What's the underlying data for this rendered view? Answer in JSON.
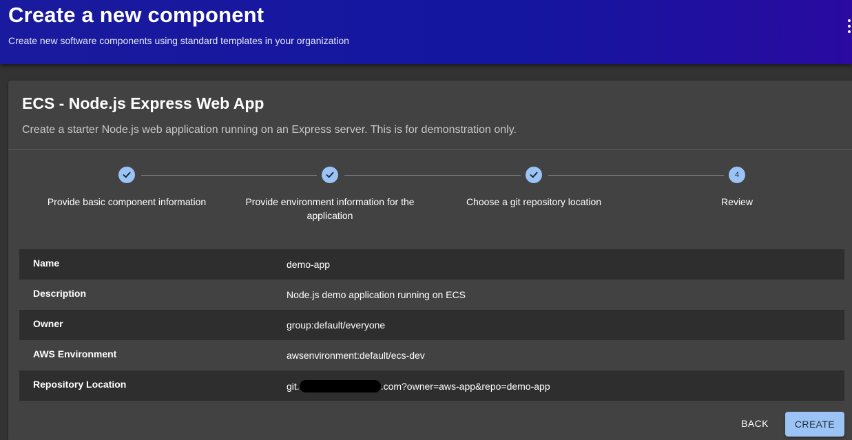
{
  "header": {
    "title": "Create a new component",
    "subtitle": "Create new software components using standard templates in your organization",
    "menu_icon": "more-vertical-icon"
  },
  "template": {
    "title": "ECS - Node.js Express Web App",
    "description": "Create a starter Node.js web application running on an Express server. This is for demonstration only."
  },
  "stepper": {
    "steps": [
      {
        "label": "Provide basic component information",
        "state": "completed",
        "icon": "check-icon"
      },
      {
        "label": "Provide environment information for the application",
        "state": "completed",
        "icon": "check-icon"
      },
      {
        "label": "Choose a git repository location",
        "state": "completed",
        "icon": "check-icon"
      },
      {
        "label": "Review",
        "state": "active",
        "number": "4"
      }
    ]
  },
  "review": {
    "rows": [
      {
        "key": "Name",
        "value": "demo-app"
      },
      {
        "key": "Description",
        "value": "Node.js demo application running on ECS"
      },
      {
        "key": "Owner",
        "value": "group:default/everyone"
      },
      {
        "key": "AWS Environment",
        "value": "awsenvironment:default/ecs-dev"
      },
      {
        "key": "Repository Location",
        "value_prefix": "git.",
        "value_suffix": ".com?owner=aws-app&repo=demo-app"
      }
    ]
  },
  "actions": {
    "back_label": "BACK",
    "create_label": "CREATE"
  },
  "colors": {
    "header_gradient_start": "#1a1a9e",
    "header_gradient_end": "#2a0aa0",
    "accent": "#9cc3f5",
    "card_bg": "#424242",
    "page_bg": "#333333"
  }
}
